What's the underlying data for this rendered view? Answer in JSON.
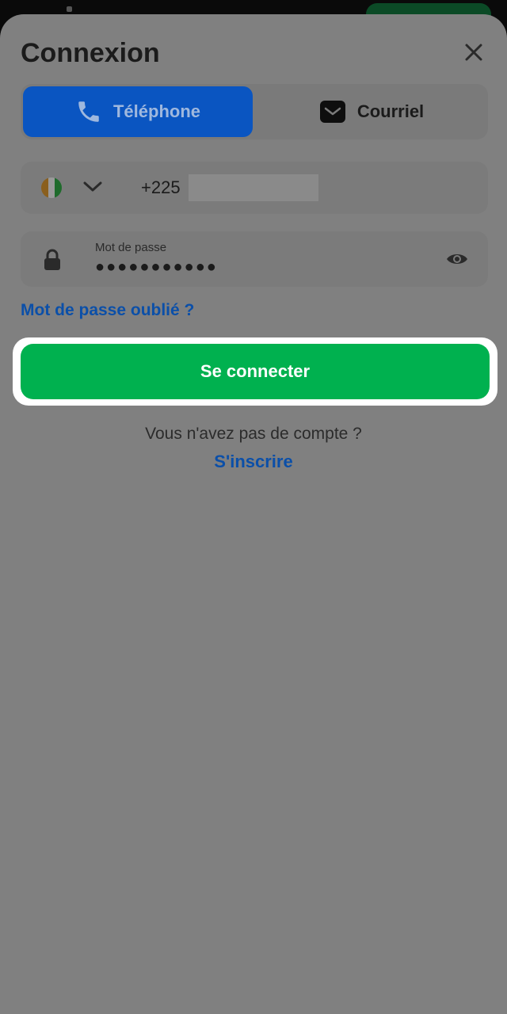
{
  "header": {
    "title": "Connexion"
  },
  "tabs": [
    {
      "label": "Téléphone",
      "icon": "phone-icon",
      "selected": true
    },
    {
      "label": "Courriel",
      "icon": "envelope-icon",
      "selected": false
    }
  ],
  "phone": {
    "country_flag": "flag-icon-cote-divoire",
    "dial_code": "+225"
  },
  "password": {
    "label": "Mot de passe",
    "value": "●●●●●●●●●●●"
  },
  "links": {
    "forgot_password": "Mot de passe oublié ?",
    "no_account": "Vous n'avez pas de compte ?",
    "signup": "S'inscrire"
  },
  "actions": {
    "login_label": "Se connecter"
  },
  "colors": {
    "primary_blue": "#0a55c1",
    "cta_green": "#00b14f",
    "link_blue": "#0b4fa8",
    "overlay_gray": "#808080"
  }
}
